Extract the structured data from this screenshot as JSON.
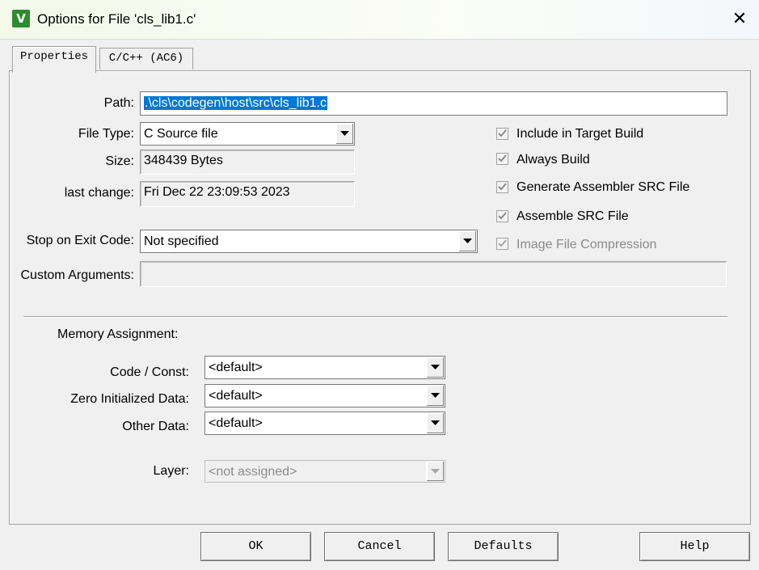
{
  "window": {
    "title": "Options for File 'cls_lib1.c'",
    "icon": "uvision-icon",
    "close_glyph": "✕"
  },
  "tabs": [
    {
      "label": "Properties",
      "active": true
    },
    {
      "label": "C/C++ (AC6)",
      "active": false
    }
  ],
  "properties": {
    "path_label": "Path:",
    "path_value": ".\\cls\\codegen\\host\\src\\cls_lib1.c",
    "file_type_label": "File Type:",
    "file_type_value": "C Source file",
    "size_label": "Size:",
    "size_value": "348439 Bytes",
    "last_change_label": "last change:",
    "last_change_value": "Fri Dec 22 23:09:53 2023",
    "stop_on_exit_label": "Stop on Exit Code:",
    "stop_on_exit_value": "Not specified",
    "custom_args_label": "Custom Arguments:",
    "custom_args_value": ""
  },
  "options": [
    {
      "label": "Include in Target Build",
      "checked": true,
      "enabled": true
    },
    {
      "label": "Always Build",
      "checked": true,
      "enabled": true
    },
    {
      "label": "Generate Assembler SRC File",
      "checked": true,
      "enabled": true
    },
    {
      "label": "Assemble SRC File",
      "checked": true,
      "enabled": true
    },
    {
      "label": "Image File Compression",
      "checked": true,
      "enabled": false
    }
  ],
  "memory": {
    "heading": "Memory Assignment:",
    "code_const_label": "Code / Const:",
    "code_const_value": "<default>",
    "zero_init_label": "Zero Initialized Data:",
    "zero_init_value": "<default>",
    "other_data_label": "Other Data:",
    "other_data_value": "<default>",
    "layer_label": "Layer:",
    "layer_value": "<not assigned>"
  },
  "buttons": {
    "ok": "OK",
    "cancel": "Cancel",
    "defaults": "Defaults",
    "help": "Help"
  },
  "colors": {
    "selection": "#0078d7",
    "disabled_text": "#8a8a8a",
    "icon_green": "#2e8b2e"
  }
}
